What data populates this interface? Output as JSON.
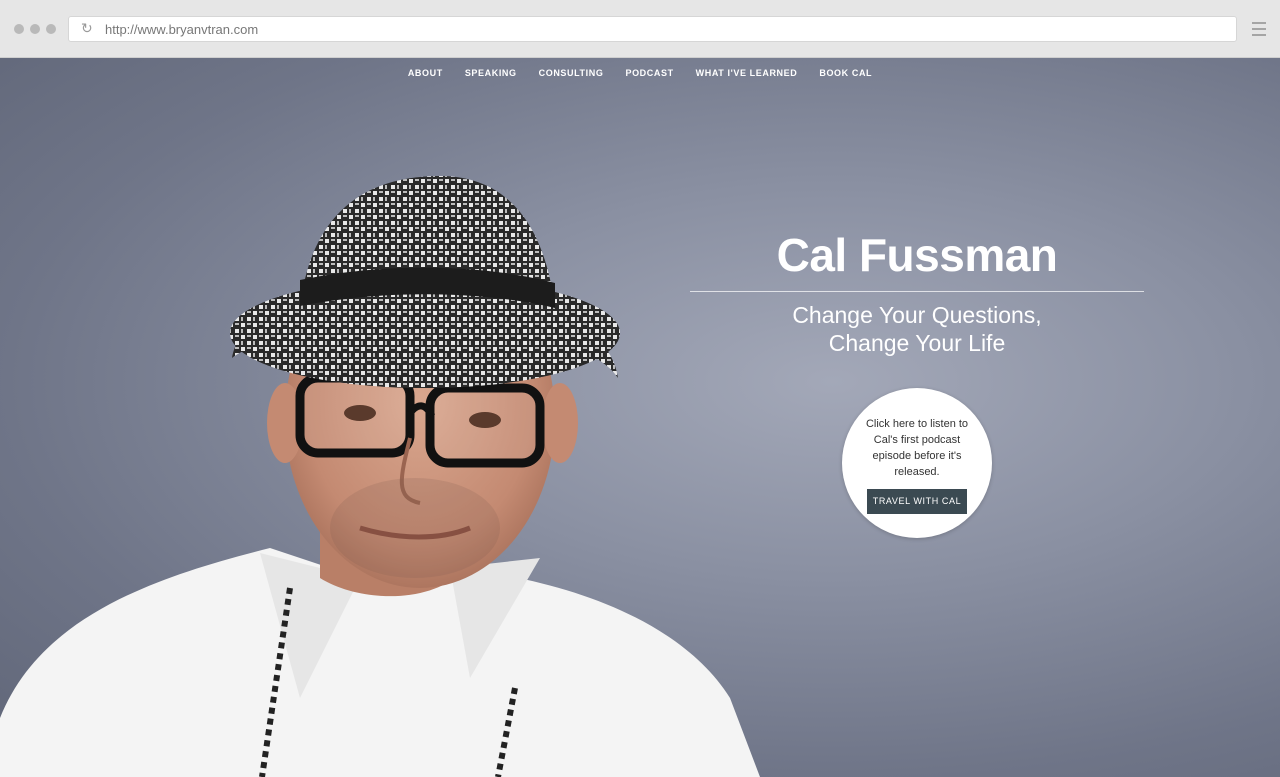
{
  "browser": {
    "url": "http://www.bryanvtran.com"
  },
  "nav": {
    "items": [
      {
        "label": "ABOUT"
      },
      {
        "label": "SPEAKING"
      },
      {
        "label": "CONSULTING"
      },
      {
        "label": "PODCAST"
      },
      {
        "label": "WHAT I'VE LEARNED"
      },
      {
        "label": "BOOK CAL"
      }
    ]
  },
  "hero": {
    "title": "Cal Fussman",
    "tagline_line1": "Change Your Questions,",
    "tagline_line2": "Change Your Life"
  },
  "promo": {
    "text": "Click here to listen to Cal's first podcast episode before it's released.",
    "button_label": "TRAVEL WITH CAL"
  }
}
